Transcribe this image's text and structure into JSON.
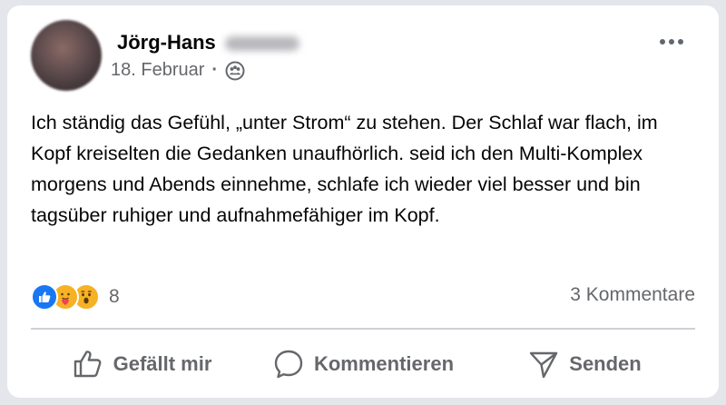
{
  "post": {
    "author_first": "Jörg-Hans",
    "date": "18. Februar",
    "separator": "·",
    "audience_icon": "friends-icon",
    "body": "Ich ständig das Gefühl, „unter Strom“ zu stehen. Der Schlaf war flach, im Kopf kreiselten die Gedanken unaufhörlich. seid ich den Multi-Komplex morgens und Abends einnehme, schlafe ich wieder viel besser und bin tagsüber ruhiger und aufnahmefähiger im Kopf."
  },
  "reactions": {
    "types": [
      "like",
      "care",
      "wow"
    ],
    "count": "8"
  },
  "comments": {
    "count_label": "3 Kommentare"
  },
  "actions": {
    "like_label": "Gefällt mir",
    "comment_label": "Kommentieren",
    "share_label": "Senden"
  },
  "colors": {
    "like_blue": "#1877f2",
    "emoji_yellow": "#f7b125",
    "secondary_text": "#65676b",
    "primary_text": "#050505"
  }
}
